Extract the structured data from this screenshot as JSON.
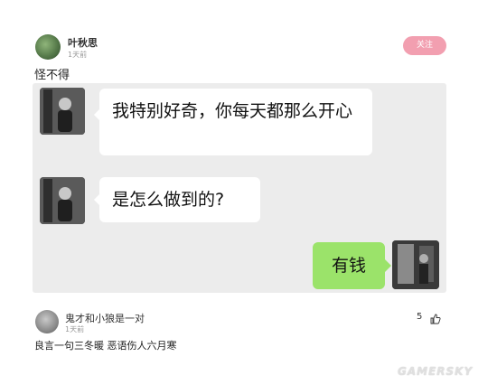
{
  "post": {
    "username": "叶秋思",
    "time": "1天前",
    "follow_label": "关注",
    "text": "怪不得"
  },
  "chat": {
    "messages": [
      {
        "side": "left",
        "text": "我特别好奇，你每天都那么开心"
      },
      {
        "side": "left",
        "text": "是怎么做到的?"
      },
      {
        "side": "right",
        "text": "有钱"
      }
    ]
  },
  "comment": {
    "username": "鬼才和小狼是一对",
    "time": "1天前",
    "likes": "5",
    "like_icon": "thumbs-up-icon",
    "text": "良言一句三冬暖 恶语伤人六月寒"
  },
  "watermark": "GAMERSKY"
}
